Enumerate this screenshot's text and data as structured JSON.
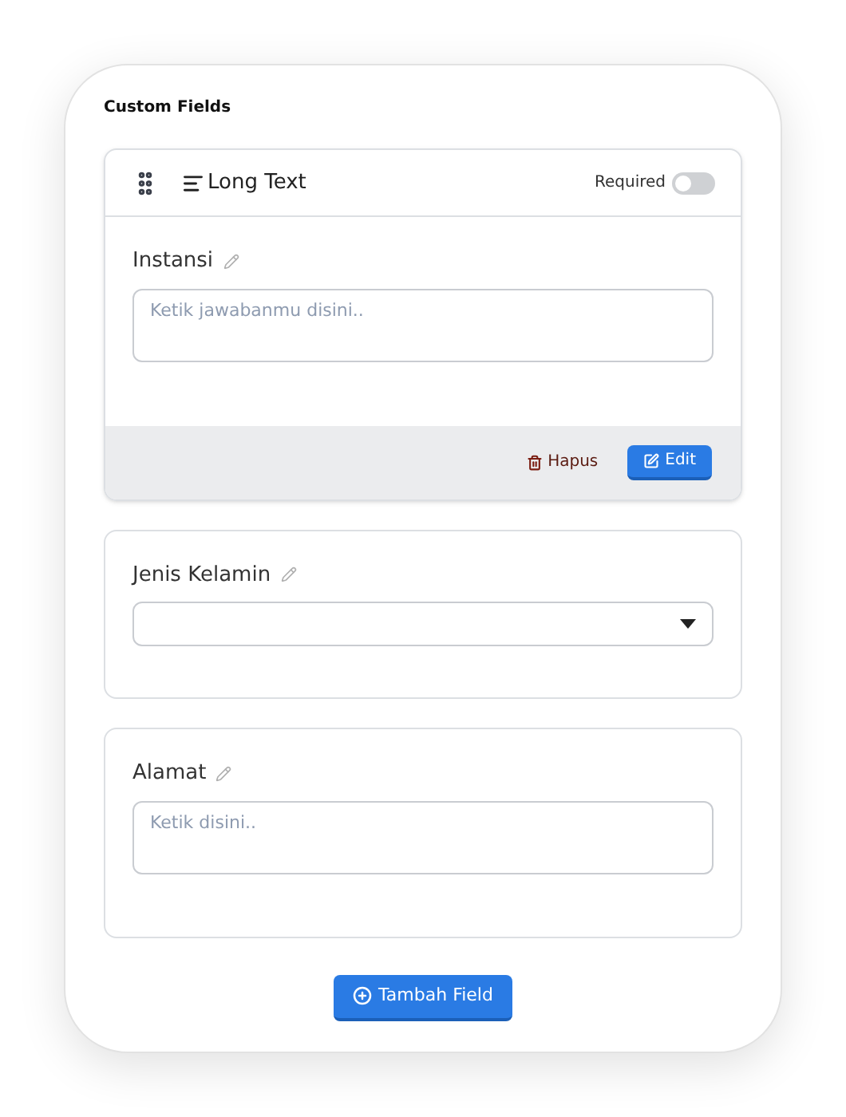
{
  "title": "Custom Fields",
  "fields": [
    {
      "kind": "textarea",
      "label": "Instansi",
      "placeholder": "Ketik jawabanmu disini..",
      "active": true,
      "type_label": "Long Text",
      "required_label": "Required",
      "required": false,
      "delete_label": "Hapus",
      "edit_label": "Edit"
    },
    {
      "kind": "select",
      "label": "Jenis Kelamin",
      "active": false
    },
    {
      "kind": "textarea",
      "label": "Alamat",
      "placeholder": "Ketik disini..",
      "active": false
    }
  ],
  "add_button": "Tambah Field"
}
